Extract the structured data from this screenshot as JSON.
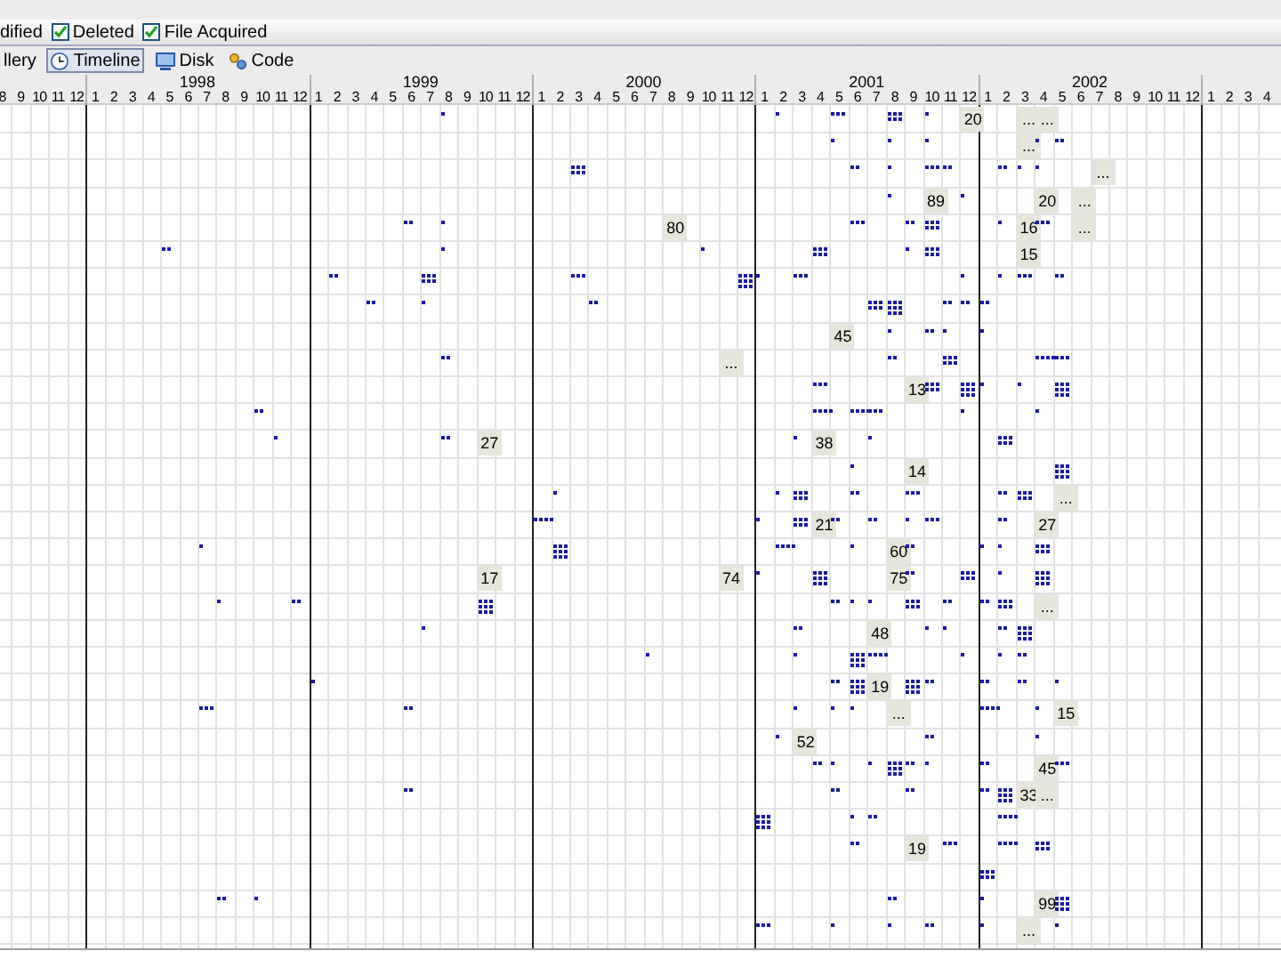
{
  "filter_bar": {
    "partial_label": "dified",
    "filters": [
      {
        "label": "Deleted",
        "checked": true
      },
      {
        "label": "File Acquired",
        "checked": true
      }
    ]
  },
  "tabs": [
    {
      "label": "llery",
      "kind": "none",
      "selected": false
    },
    {
      "label": "Timeline",
      "kind": "clock",
      "selected": true
    },
    {
      "label": "Disk",
      "kind": "monitor",
      "selected": false
    },
    {
      "label": "Code",
      "kind": "code",
      "selected": false
    }
  ],
  "timeline": {
    "lead_months": [
      "8",
      "9",
      "10",
      "11",
      "12"
    ],
    "years": [
      {
        "year": "1998",
        "months": [
          "1",
          "2",
          "3",
          "4",
          "5",
          "6",
          "7",
          "8",
          "9",
          "10",
          "11",
          "12"
        ]
      },
      {
        "year": "1999",
        "months": [
          "1",
          "2",
          "3",
          "4",
          "5",
          "6",
          "7",
          "8",
          "9",
          "10",
          "11",
          "12"
        ]
      },
      {
        "year": "2000",
        "months": [
          "1",
          "2",
          "3",
          "4",
          "5",
          "6",
          "7",
          "8",
          "9",
          "10",
          "11",
          "12"
        ]
      },
      {
        "year": "2001",
        "months": [
          "1",
          "2",
          "3",
          "4",
          "5",
          "6",
          "7",
          "8",
          "9",
          "10",
          "11",
          "12"
        ]
      },
      {
        "year": "2002",
        "months": [
          "1",
          "2",
          "3",
          "4",
          "5",
          "6",
          "7",
          "8",
          "9",
          "10",
          "11",
          "12"
        ]
      }
    ],
    "trail_months": [
      "1",
      "2",
      "3",
      "4"
    ],
    "counts": [
      "20",
      "...",
      "...",
      "...",
      "...",
      "89",
      "20",
      "...",
      "80",
      "16",
      "...",
      "15",
      "45",
      "...",
      "13",
      "27",
      "38",
      "14",
      "...",
      "21",
      "27",
      "60",
      "17",
      "74",
      "75",
      "...",
      "48",
      "19",
      "...",
      "15",
      "52",
      "45",
      "33",
      "...",
      "19",
      "99",
      "..."
    ]
  }
}
